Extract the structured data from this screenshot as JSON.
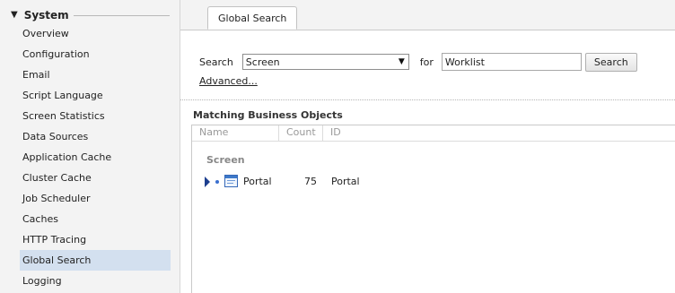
{
  "sidebar": {
    "section_title": "System",
    "items": [
      {
        "label": "Overview"
      },
      {
        "label": "Configuration"
      },
      {
        "label": "Email"
      },
      {
        "label": "Script Language"
      },
      {
        "label": "Screen Statistics"
      },
      {
        "label": "Data Sources"
      },
      {
        "label": "Application Cache"
      },
      {
        "label": "Cluster Cache"
      },
      {
        "label": "Job Scheduler"
      },
      {
        "label": "Caches"
      },
      {
        "label": "HTTP Tracing"
      },
      {
        "label": "Global Search",
        "selected": true
      },
      {
        "label": "Logging"
      }
    ]
  },
  "tab": {
    "label": "Global Search"
  },
  "search": {
    "search_label": "Search",
    "type_value": "Screen",
    "for_label": "for",
    "query_value": "Worklist",
    "button_label": "Search",
    "advanced_label": "Advanced..."
  },
  "results": {
    "title": "Matching Business Objects",
    "columns": {
      "name": "Name",
      "count": "Count",
      "id": "ID"
    },
    "group": "Screen",
    "rows": [
      {
        "name": "Portal",
        "count": "75",
        "id": "Portal"
      }
    ]
  },
  "colors": {
    "selected_bg": "#d3e0ef",
    "accent": "#1d3f8f",
    "sidebar_bg": "#f3f3f3"
  }
}
